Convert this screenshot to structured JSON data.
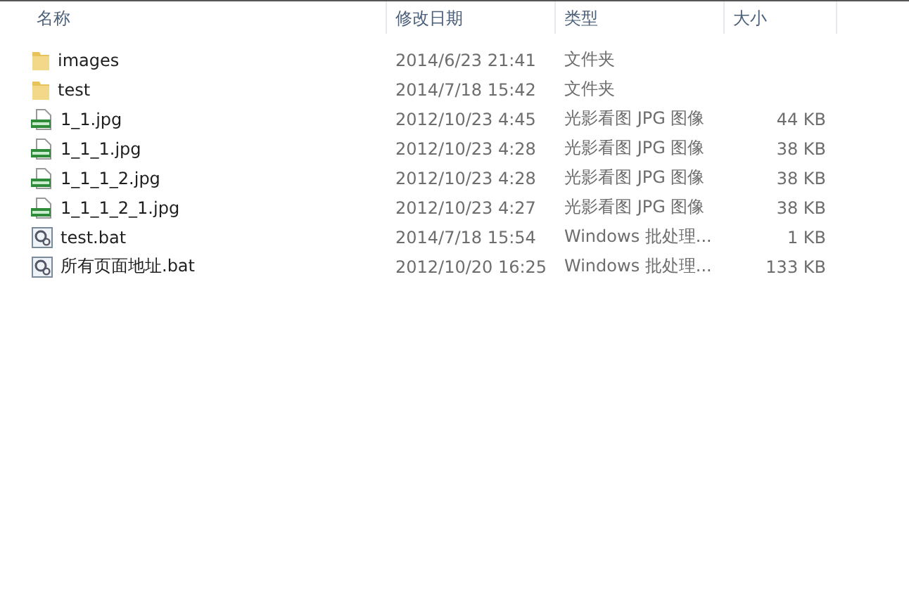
{
  "columns": [
    "名称",
    "修改日期",
    "类型",
    "大小"
  ],
  "rows": [
    {
      "kind": "folder",
      "name": "images",
      "modified": "2014/6/23 21:41",
      "type": "文件夹",
      "size": ""
    },
    {
      "kind": "folder",
      "name": "test",
      "modified": "2014/7/18 15:42",
      "type": "文件夹",
      "size": ""
    },
    {
      "kind": "jpeg",
      "name": "1_1.jpg",
      "modified": "2012/10/23 4:45",
      "type": "光影看图 JPG 图像",
      "size": "44 KB"
    },
    {
      "kind": "jpeg",
      "name": "1_1_1.jpg",
      "modified": "2012/10/23 4:28",
      "type": "光影看图 JPG 图像",
      "size": "38 KB"
    },
    {
      "kind": "jpeg",
      "name": "1_1_1_2.jpg",
      "modified": "2012/10/23 4:28",
      "type": "光影看图 JPG 图像",
      "size": "38 KB"
    },
    {
      "kind": "jpeg",
      "name": "1_1_1_2_1.jpg",
      "modified": "2012/10/23 4:27",
      "type": "光影看图 JPG 图像",
      "size": "38 KB"
    },
    {
      "kind": "bat",
      "name": "test.bat",
      "modified": "2014/7/18 15:54",
      "type": "Windows 批处理...",
      "size": "1 KB"
    },
    {
      "kind": "bat",
      "name": "所有页面地址.bat",
      "modified": "2012/10/20 16:25",
      "type": "Windows 批处理...",
      "size": "133 KB"
    }
  ]
}
